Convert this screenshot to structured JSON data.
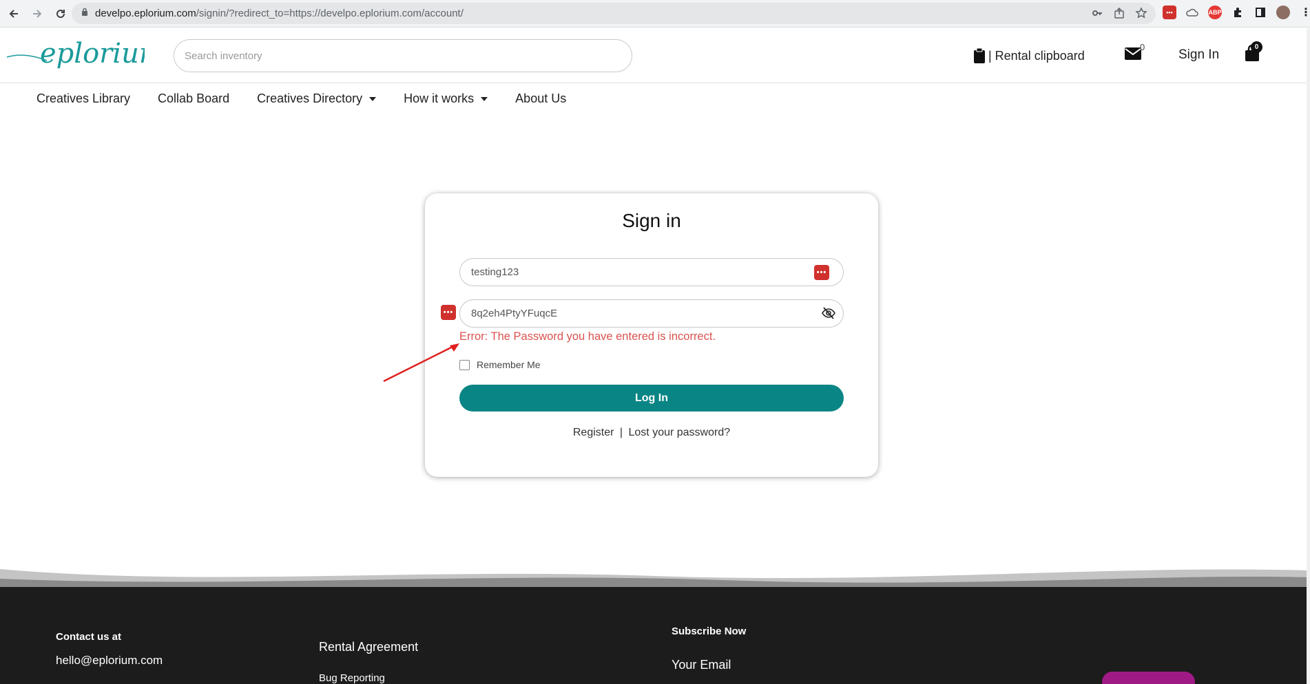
{
  "browser": {
    "url_host": "develpo.eplorium.com",
    "url_path": "/signin/?redirect_to=https://develpo.eplorium.com/account/"
  },
  "header": {
    "logo_text": "eplorium",
    "search_placeholder": "Search inventory",
    "clipboard_label": "| Rental clipboard",
    "messages_count": "0",
    "signin_label": "Sign In",
    "cart_count": "0"
  },
  "nav": {
    "items": [
      {
        "label": "Creatives Library",
        "dropdown": false
      },
      {
        "label": "Collab Board",
        "dropdown": false
      },
      {
        "label": "Creatives Directory",
        "dropdown": true
      },
      {
        "label": "How it works",
        "dropdown": true
      },
      {
        "label": "About Us",
        "dropdown": false
      }
    ]
  },
  "signin": {
    "title": "Sign in",
    "username_value": "testing123",
    "password_value": "8q2eh4PtyYFuqcE",
    "error": "Error: The Password you have entered is incorrect.",
    "remember_label": "Remember Me",
    "login_button": "Log In",
    "register_link": "Register",
    "separator": "|",
    "lost_password_link": "Lost your password?"
  },
  "footer": {
    "contact_title": "Contact us at",
    "contact_email": "hello@eplorium.com",
    "rental_agreement": "Rental Agreement",
    "bug_reporting": "Bug Reporting",
    "subscribe_title": "Subscribe Now",
    "your_email": "Your Email"
  },
  "colors": {
    "accent": "#0a8585",
    "error": "#d9534f",
    "footer_bg": "#1c1c1c",
    "subscribe_button": "#a01a86"
  }
}
